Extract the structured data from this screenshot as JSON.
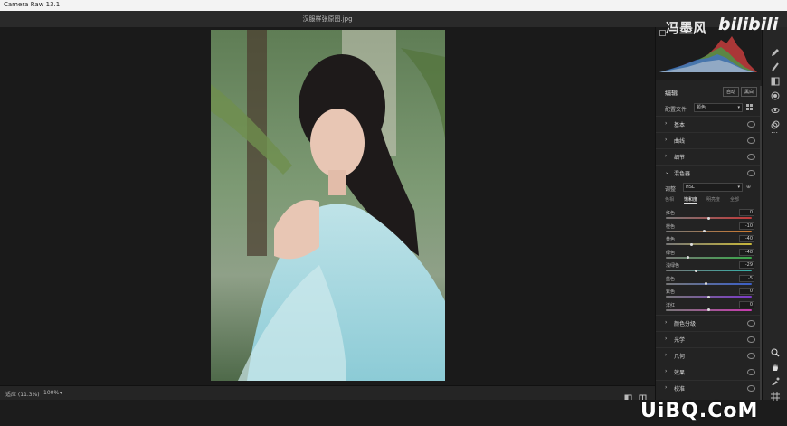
{
  "app": {
    "title": "Camera Raw 13.1",
    "file_name": "汉服样张原图.jpg"
  },
  "panel": {
    "edit_title": "编辑",
    "auto_label": "自动",
    "bw_label": "黑白",
    "profile_label": "配置文件",
    "profile_value": "颜色",
    "sections_top": [
      {
        "label": "基本"
      },
      {
        "label": "曲线"
      },
      {
        "label": "细节"
      },
      {
        "label": "混色器"
      }
    ],
    "mixer": {
      "adjust_label": "调整",
      "adjust_value": "HSL",
      "tabs": [
        "色相",
        "饱和度",
        "明亮度",
        "全部"
      ],
      "active_tab": "饱和度",
      "sliders": [
        {
          "label": "红色",
          "value": "0",
          "pos": 0.5,
          "color": "#c23a3a"
        },
        {
          "label": "橙色",
          "value": "-10",
          "pos": 0.45,
          "color": "#cf7a2e"
        },
        {
          "label": "黄色",
          "value": "-40",
          "pos": 0.3,
          "color": "#c9b83a"
        },
        {
          "label": "绿色",
          "value": "-48",
          "pos": 0.26,
          "color": "#3aa84a"
        },
        {
          "label": "浅绿色",
          "value": "-29",
          "pos": 0.35,
          "color": "#35b0a8"
        },
        {
          "label": "蓝色",
          "value": "-5",
          "pos": 0.47,
          "color": "#3a5fc9"
        },
        {
          "label": "紫色",
          "value": "0",
          "pos": 0.5,
          "color": "#7b3ac9"
        },
        {
          "label": "洋红",
          "value": "0",
          "pos": 0.5,
          "color": "#c93ab0"
        }
      ]
    },
    "sections_bottom": [
      {
        "label": "颜色分级"
      },
      {
        "label": "光学"
      },
      {
        "label": "几何"
      },
      {
        "label": "效果"
      },
      {
        "label": "校准"
      }
    ]
  },
  "bottombar": {
    "view_label": "适应 (11.3%)",
    "zoom_value": "100%"
  },
  "watermarks": {
    "author": "冯墨风",
    "site": "bilibili",
    "logo": "UiBQ.CoM"
  },
  "icons": [
    "pencil-icon",
    "brush-icon",
    "gradient-icon",
    "radial-icon",
    "redeye-icon",
    "presets-icon",
    "more-icon",
    "zoom-icon",
    "hand-icon",
    "sampler-icon",
    "grid-icon"
  ]
}
